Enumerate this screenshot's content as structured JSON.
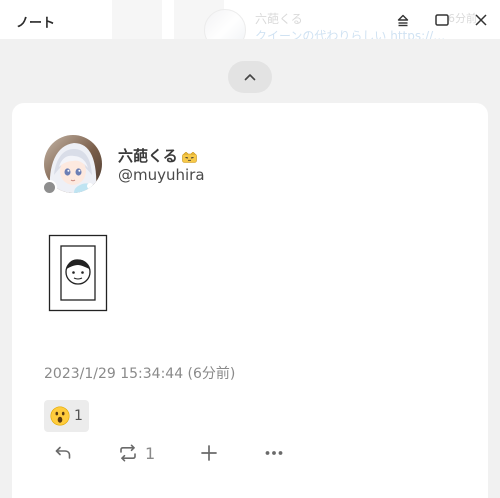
{
  "window": {
    "title": "ノート"
  },
  "background_note": {
    "display_name": "六葩くる",
    "text": "クイーンの代わりらしい https://…",
    "time": "6分前"
  },
  "note": {
    "author": {
      "display_name": "六葩くる",
      "username": "@muyuhira",
      "online_status": "offline"
    },
    "timestamp": "2023/1/29 15:34:44 (6分前)",
    "reactions": [
      {
        "emoji": "😮",
        "count": "1"
      }
    ],
    "actions": {
      "renote_count": "1"
    }
  },
  "colors": {
    "page_background": "#f1f1f1",
    "card_background": "#ffffff",
    "reaction_background": "#ececec",
    "muted_text": "#8a8a8a",
    "status_offline": "#8e8e8e",
    "link": "#2c7fc8"
  },
  "icons": {
    "header": [
      "collapse-icon",
      "maximize-icon",
      "close-icon"
    ],
    "scroll": "chevron-up-icon",
    "actions": [
      "reply-icon",
      "renote-icon",
      "plus-icon",
      "more-icon"
    ],
    "attachment": "file-icon"
  }
}
